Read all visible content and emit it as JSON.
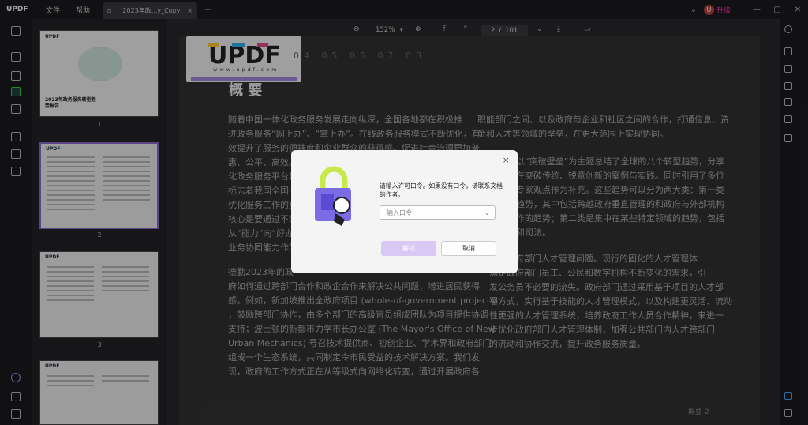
{
  "app": {
    "logo": "UPDF"
  },
  "menu": [
    "文件",
    "帮助"
  ],
  "tab": {
    "title": "2023年政...y_Copy",
    "close": "×",
    "add": "+"
  },
  "user": {
    "avatar": "U",
    "upgrade_label": "升级"
  },
  "toolbar": {
    "zoom": "152%",
    "page_current": "2",
    "page_total": "101"
  },
  "thumbnails": [
    {
      "title": "2023年政务服务转型趋势报告",
      "num": "1"
    },
    {
      "num": "2"
    },
    {
      "num": "3"
    }
  ],
  "document": {
    "logo_url_text": "www.updf.com",
    "headline": "概 要",
    "section_numbers": "04 05 06 07 08",
    "left_para1": [
      "随着中国一体化政务服务发展走向纵深，全国各地都在积极推",
      "进政务服务“网上办”、“掌上办”。在线政务服务模式不断优化，有",
      "效提升了服务的便捷度和企业群众的获得感。促进社会治理更加普",
      "惠、公平、高效。2",
      "化政务服务平台建",
      "标志着我国全国一",
      "优化服务工作的重",
      "核心是要通过不断",
      "从“能力”向“好办",
      "业务协同能力作为"
    ],
    "left_para2": [
      "德勤2023年的政",
      "府如何通过跨部门合作和政企合作来解决公共问题，增进居民获得",
      "感。例如，新加坡推出全政府项目 (whole-of-government projects)",
      "，鼓励跨部门协作，由多个部门的高级官员组成团队为项目提供协调",
      "支持；波士顿的新都市力学市长办公室 (The Mayor's Office of New",
      "Urban Mechanics) 号召技术提供商、初创企业、学术界和政府部门",
      "组成一个生态系统，共同制定令市民受益的技术解决方案。我们发",
      "现，政府的工作方式正在从等级式向网络化转变，通过开展政府各"
    ],
    "right_para1": [
      "职能部门之间、以及政府与企业和社区之间的合作，打通信息、资",
      "金和人才等领域的壁垒，在更大范围上实现协同。"
    ],
    "right_para2": [
      "以“突破壁垒”为主题总结了全球的八个转型趋势，分享",
      "在突破传统、锐意创新的案例与实践。同时引用了多位",
      "专家观点作为补充。这些趋势可以分为两大类：第一类",
      "趋势，其中包括跨越政府垂直管理的和政府与外部机构",
      "作的趋势；第二类是集中在某些特定领域的趋势，包括",
      "和司法。"
    ],
    "right_para3": [
      "聚焦政府部门人才管理问题。现行的固化的人才管理体",
      "满足政府部门员工、公民和数字机构不断变化的需求，引",
      "发公务员不必要的流失。政府部门通过采用基于项目的人才部",
      "署方式，实行基于技能的人才管理模式，以及构建更灵活、流动",
      "性更强的人才管理系统，培养政府工作人员合作精神，来进一",
      "步优化政府部门人才管理体制，加强公共部门内人才跨部门",
      "的流动和协作交流，提升政务服务质量。"
    ],
    "footer": "概要  2"
  },
  "dialog": {
    "message": "请输入许可口令。如果没有口令，请联系文档的作者。",
    "input_placeholder": "输入口令",
    "unlock_label": "解锁",
    "cancel_label": "取消",
    "close": "×"
  }
}
